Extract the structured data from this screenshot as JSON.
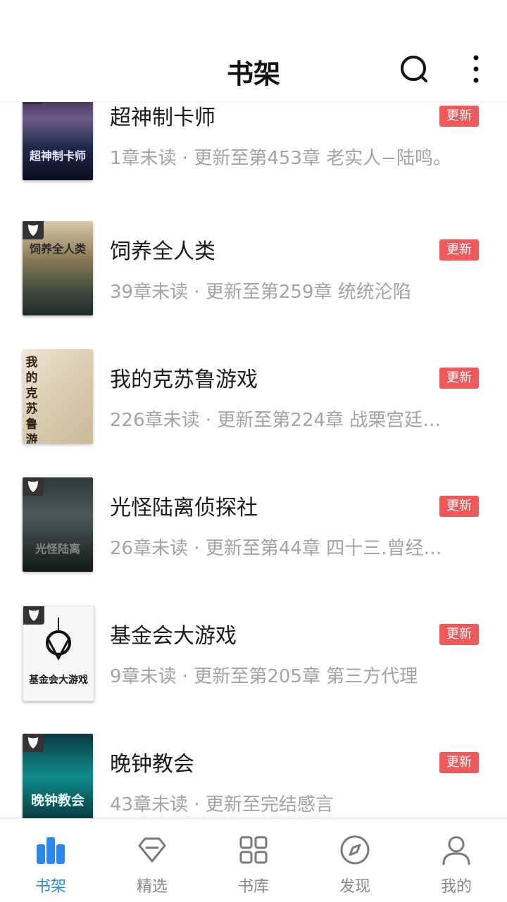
{
  "header": {
    "title": "书架"
  },
  "icons": {
    "search": "search-icon",
    "more": "more-vertical-icon",
    "cover_badge": "mask-icon"
  },
  "colors": {
    "accent": "#2a86f0",
    "badge": "#f0585a",
    "muted": "#a3a3a3"
  },
  "books": [
    {
      "name": "超神制卡师",
      "badge": "更新",
      "meta": "1章未读 · 更新至第453章 老实人−陆鸣。",
      "cover_text": "超神制卡师"
    },
    {
      "name": "饲养全人类",
      "badge": "更新",
      "meta": "39章未读 · 更新至第259章 统统沦陷",
      "cover_text": "饲养全人类"
    },
    {
      "name": "我的克苏鲁游戏",
      "badge": "更新",
      "meta": "226章未读 · 更新至第224章 战栗宫廷…",
      "cover_text": "我的克苏鲁游戏"
    },
    {
      "name": "光怪陆离侦探社",
      "badge": "更新",
      "meta": "26章未读 · 更新至第44章 四十三.曾经…",
      "cover_text": "光怪陆离"
    },
    {
      "name": "基金会大游戏",
      "badge": "更新",
      "meta": "9章未读 · 更新至第205章 第三方代理",
      "cover_text": "基金会大游戏"
    },
    {
      "name": "晚钟教会",
      "badge": "更新",
      "meta": "43章未读 · 更新至完结感言",
      "cover_text": "晚钟教会"
    }
  ],
  "tabs": [
    {
      "label": "书架",
      "icon": "bookshelf-icon",
      "active": true
    },
    {
      "label": "精选",
      "icon": "diamond-icon",
      "active": false
    },
    {
      "label": "书库",
      "icon": "grid-icon",
      "active": false
    },
    {
      "label": "发现",
      "icon": "compass-icon",
      "active": false
    },
    {
      "label": "我的",
      "icon": "person-icon",
      "active": false
    }
  ]
}
